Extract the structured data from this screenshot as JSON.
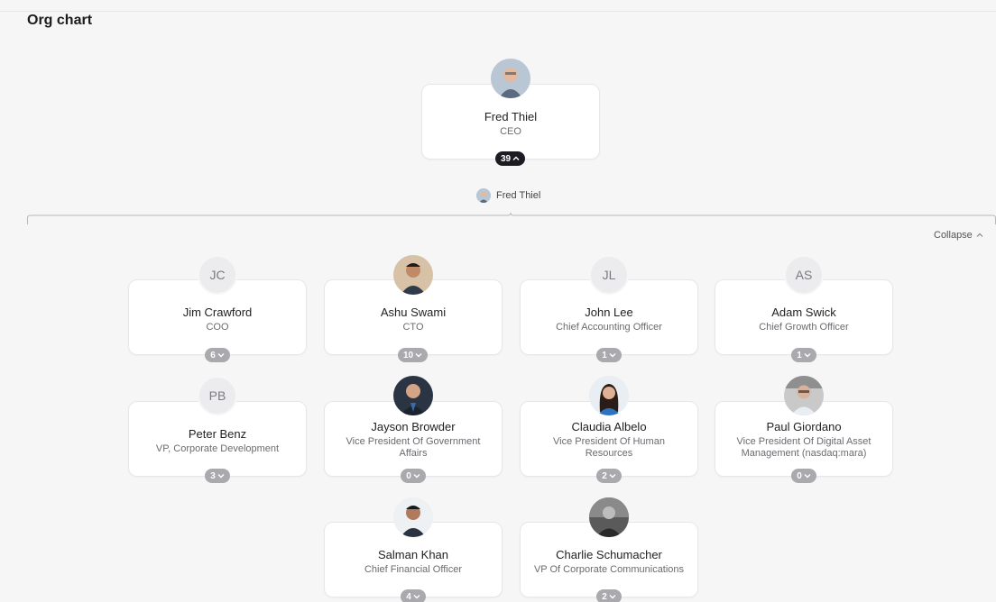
{
  "page": {
    "title": "Org chart"
  },
  "root": {
    "name": "Fred Thiel",
    "role": "CEO",
    "count": "39"
  },
  "breadcrumb": {
    "name": "Fred Thiel"
  },
  "collapse": {
    "label": "Collapse"
  },
  "people": {
    "jim": {
      "name": "Jim Crawford",
      "role": "COO",
      "initials": "JC",
      "count": "6"
    },
    "ashu": {
      "name": "Ashu Swami",
      "role": "CTO",
      "count": "10"
    },
    "john": {
      "name": "John Lee",
      "role": "Chief Accounting Officer",
      "initials": "JL",
      "count": "1"
    },
    "adam": {
      "name": "Adam Swick",
      "role": "Chief Growth Officer",
      "initials": "AS",
      "count": "1"
    },
    "peter": {
      "name": "Peter Benz",
      "role": "VP, Corporate Development",
      "initials": "PB",
      "count": "3"
    },
    "jayson": {
      "name": "Jayson Browder",
      "role": "Vice President Of Government Affairs",
      "count": "0"
    },
    "claudia": {
      "name": "Claudia Albelo",
      "role": "Vice President Of Human Resources",
      "count": "2"
    },
    "paul": {
      "name": "Paul Giordano",
      "role": "Vice President Of Digital Asset Management (nasdaq:mara)",
      "count": "0"
    },
    "salman": {
      "name": "Salman Khan",
      "role": "Chief Financial Officer",
      "count": "4"
    },
    "charlie": {
      "name": "Charlie Schumacher",
      "role": "VP Of Corporate Communications",
      "count": "2"
    }
  },
  "icons": {
    "chevron_up": "chevron-up-icon",
    "chevron_down": "chevron-down-icon"
  },
  "colors": {
    "badge_dark": "#1c1c22",
    "badge_gray": "#a9a9ae",
    "card_border": "#e7e7ea"
  }
}
